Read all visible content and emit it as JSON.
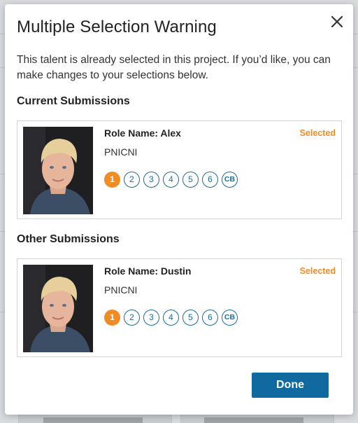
{
  "modal": {
    "title": "Multiple Selection Warning",
    "message": "This talent is already selected in this project. If you’d like, you can make changes to your selections below.",
    "close_icon": "close-icon",
    "done_label": "Done"
  },
  "current": {
    "heading": "Current Submissions",
    "card": {
      "role_name": "Role Name: Alex",
      "agency": "PNICNI",
      "status": "Selected",
      "choices": [
        "1",
        "2",
        "3",
        "4",
        "5",
        "6",
        "CB"
      ],
      "active_choice": "1"
    }
  },
  "other": {
    "heading": "Other Submissions",
    "card": {
      "role_name": "Role Name: Dustin",
      "agency": "PNICNI",
      "status": "Selected",
      "choices": [
        "1",
        "2",
        "3",
        "4",
        "5",
        "6",
        "CB"
      ],
      "active_choice": "1"
    }
  },
  "colors": {
    "accent_orange": "#f08c24",
    "primary_blue": "#0f6aa0",
    "choice_blue": "#1c6e9c"
  }
}
